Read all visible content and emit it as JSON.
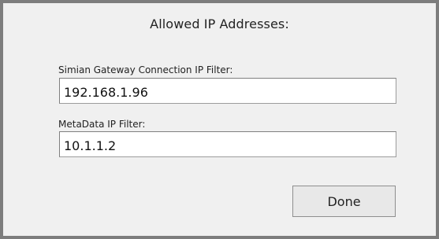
{
  "dialog": {
    "title": "Allowed IP Addresses:"
  },
  "fields": {
    "gateway": {
      "label": "Simian Gateway Connection IP Filter:",
      "value": "192.168.1.96"
    },
    "metadata": {
      "label": "MetaData IP Filter:",
      "value": "10.1.1.2"
    }
  },
  "buttons": {
    "done_label": "Done"
  }
}
